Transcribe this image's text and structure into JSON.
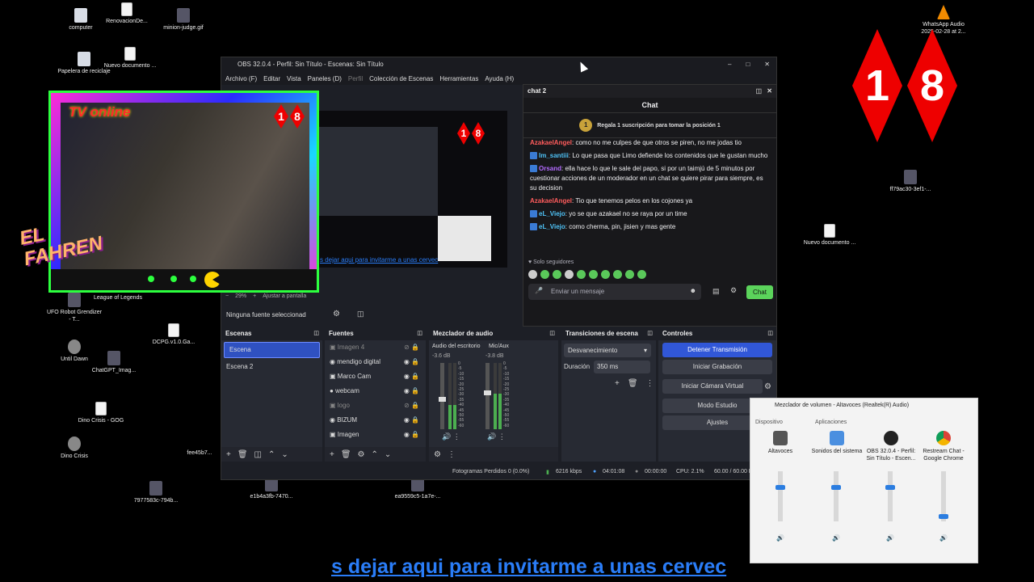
{
  "desktop_icons": [
    {
      "label": "computer",
      "icon": "computer-icon"
    },
    {
      "label": "RenovacionDe...",
      "icon": "pdf-icon"
    },
    {
      "label": "minion-judge.gif",
      "icon": "gif-icon"
    },
    {
      "label": "Papelera de reciclaje",
      "icon": "recycle-bin-icon"
    },
    {
      "label": "Nuevo documento ...",
      "icon": "document-icon"
    },
    {
      "label": "UFO Robot Grendizer - T...",
      "icon": "game-icon"
    },
    {
      "label": "League of Legends",
      "icon": "game-icon"
    },
    {
      "label": "Until Dawn",
      "icon": "game-icon"
    },
    {
      "label": "ChatGPT_Imag...",
      "icon": "image-icon"
    },
    {
      "label": "DCPG.v1.0.Ga...",
      "icon": "document-icon"
    },
    {
      "label": "Dino Crisis - GOG",
      "icon": "game-icon"
    },
    {
      "label": "Dino Crisis",
      "icon": "game-icon"
    },
    {
      "label": "fee45b7...",
      "icon": "image-icon"
    },
    {
      "label": "7977583c-794b...",
      "icon": "image-icon"
    },
    {
      "label": "e1b4a3fb-7470...",
      "icon": "image-icon"
    },
    {
      "label": "ea9559c5-1a7e-...",
      "icon": "image-icon"
    },
    {
      "label": "WhatsApp Audio 2025-02-28 at 2...",
      "icon": "vlc-icon"
    },
    {
      "label": "ff79ac30-3ef1-...",
      "icon": "image-icon"
    },
    {
      "label": "Nuevo documento ...",
      "icon": "document-icon"
    }
  ],
  "overlay": {
    "tv_text": "TV online",
    "brand": "EL FAHREN",
    "badge": [
      "1",
      "8"
    ],
    "link_text": "s dejar aqui para invitarme a unas cervec"
  },
  "obs": {
    "title": "OBS 32.0.4 - Perfil: Sin Título - Escenas: Sin Título",
    "menu": [
      "Archivo (F)",
      "Editar",
      "Vista",
      "Paneles (D)",
      "Perfil",
      "Colección de Escenas",
      "Herramientas",
      "Ayuda (H)"
    ],
    "zoom": "29%",
    "zoom_fit": "Ajustar a pantalla",
    "no_source": "Ninguna fuente seleccionad",
    "scenes": {
      "title": "Escenas",
      "items": [
        "Escena",
        "Escena 2"
      ]
    },
    "sources": {
      "title": "Fuentes",
      "items": [
        "Imagen 4",
        "mendigo digital",
        "Marco Cam",
        "webcam",
        "logo",
        "BIZUM",
        "Imagen"
      ]
    },
    "mixer": {
      "title": "Mezclador de audio",
      "channels": [
        {
          "name": "Audio del escritorio",
          "db": "-3.6 dB",
          "level": 0.45
        },
        {
          "name": "Mic/Aux",
          "db": "-3.8 dB",
          "level": 0.55
        }
      ],
      "scale": [
        "0",
        "-5",
        "-10",
        "-15",
        "-20",
        "-25",
        "-30",
        "-35",
        "-40",
        "-45",
        "-50",
        "-55",
        "-60"
      ]
    },
    "transitions": {
      "title": "Transiciones de escena",
      "type": "Desvanecimiento",
      "duration_label": "Duración",
      "duration": "350 ms"
    },
    "controls": {
      "title": "Controles",
      "buttons": [
        "Detener Transmisión",
        "Iniciar Grabación",
        "Iniciar Cámara Virtual",
        "Modo Estudio",
        "Ajustes"
      ]
    },
    "status": {
      "dropped": "Fotogramas Perdidos 0 (0.0%)",
      "bitrate": "6216 kbps",
      "stream_time": "04:01:08",
      "rec_time": "00:00:00",
      "cpu": "CPU: 2.1%",
      "fps": "60.00 / 60.00 FPS"
    }
  },
  "chat": {
    "dock_title": "chat 2",
    "header": "Chat",
    "promo": "Regala 1 suscripción para tomar la posición 1",
    "promo_rank": "1",
    "messages": [
      {
        "user": "AzakaelAngel",
        "color": "#ff5c5c",
        "text": ": como no me culpes de que otros se piren, no me jodas tio"
      },
      {
        "user": "lm_santiii",
        "color": "#4fc3f7",
        "text": ": Lo que pasa que Limo defiende los contenidos que le gustan mucho"
      },
      {
        "user": "Orsand",
        "color": "#b36bff",
        "text": ": ella hace lo que le sale del papo, si por un taimjú de 5 minutos por cuestionar acciones de un moderador en un chat se quiere pirar para siempre, es su decision"
      },
      {
        "user": "AzakaelAngel",
        "color": "#ff5c5c",
        "text": ": Tio que tenemos pelos en los cojones ya"
      },
      {
        "user": "eL_Viejo",
        "color": "#4fc3f7",
        "text": ": yo se que azakael no se raya por un time"
      },
      {
        "user": "eL_Viejo",
        "color": "#4fc3f7",
        "text": ": como cherma, pin, jisien y mas gente"
      }
    ],
    "followers_only": "Solo seguidores",
    "input_placeholder": "Enviar un mensaje",
    "send_label": "Chat"
  },
  "volume_mixer": {
    "title": "Mezclador de volumen - Altavoces (Realtek(R) Audio)",
    "device_label": "Dispositivo",
    "apps_label": "Aplicaciones",
    "columns": [
      {
        "name": "Altavoces",
        "level": 0.7
      },
      {
        "name": "Sonidos del sistema",
        "level": 0.7
      },
      {
        "name": "OBS 32.0.4 - Perfil: Sin Título - Escen...",
        "level": 0.7
      },
      {
        "name": "Restream Chat - Google Chrome",
        "level": 0.05
      }
    ]
  }
}
